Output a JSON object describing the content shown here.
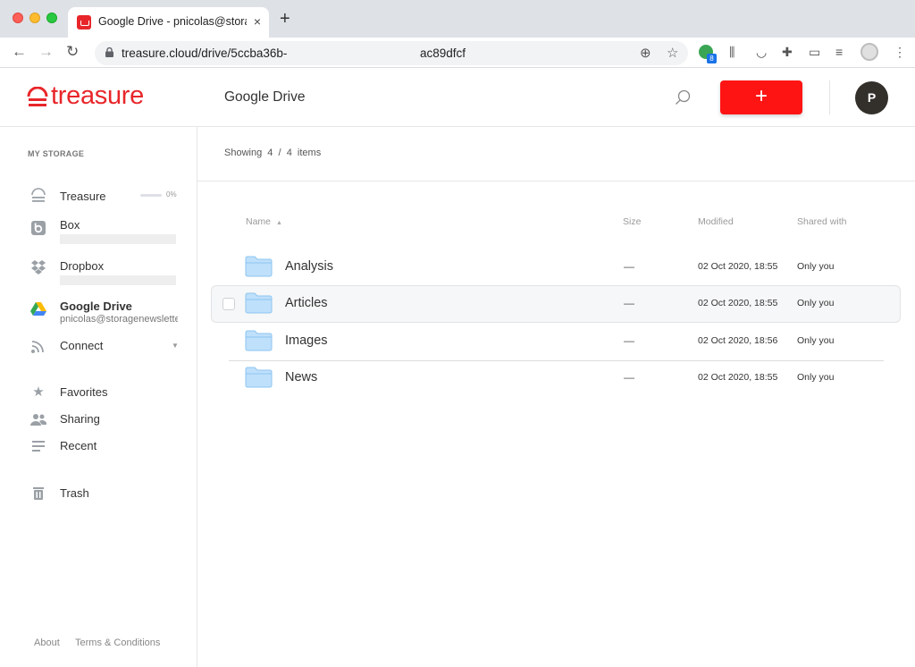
{
  "browser": {
    "tab_title": "Google Drive - pnicolas@storagenewsletter.com",
    "tab_close": "×",
    "new_tab": "+",
    "url_start": "treasure.cloud/drive/5ccba36b-",
    "url_end": "ac89dfcf",
    "extension_badge": "8"
  },
  "header": {
    "logo_text": "treasure",
    "title": "Google Drive",
    "add_button": "+",
    "avatar_initial": "P"
  },
  "sidebar": {
    "section_title": "MY STORAGE",
    "treasure": {
      "label": "Treasure",
      "usage_pct": "0%"
    },
    "box": {
      "label": "Box"
    },
    "dropbox": {
      "label": "Dropbox"
    },
    "google_drive": {
      "label": "Google Drive",
      "account": "pnicolas@storagenewsletter.com"
    },
    "connect": {
      "label": "Connect"
    },
    "favorites": {
      "label": "Favorites"
    },
    "sharing": {
      "label": "Sharing"
    },
    "recent": {
      "label": "Recent"
    },
    "trash": {
      "label": "Trash"
    },
    "footer": {
      "about": "About",
      "terms": "Terms & Conditions"
    }
  },
  "main": {
    "showing": "Showing  4  /  4  items",
    "columns": {
      "name": "Name",
      "size": "Size",
      "modified": "Modified",
      "shared": "Shared with"
    },
    "rows": [
      {
        "name": "Analysis",
        "size": "—",
        "modified": "02 Oct 2020, 18:55",
        "shared": "Only you"
      },
      {
        "name": "Articles",
        "size": "—",
        "modified": "02 Oct 2020, 18:55",
        "shared": "Only you"
      },
      {
        "name": "Images",
        "size": "—",
        "modified": "02 Oct 2020, 18:56",
        "shared": "Only you"
      },
      {
        "name": "News",
        "size": "—",
        "modified": "02 Oct 2020, 18:55",
        "shared": "Only you"
      }
    ]
  },
  "colors": {
    "brand_red": "#e8262a",
    "add_button": "#ff1414",
    "folder": "#bfe0fb"
  }
}
